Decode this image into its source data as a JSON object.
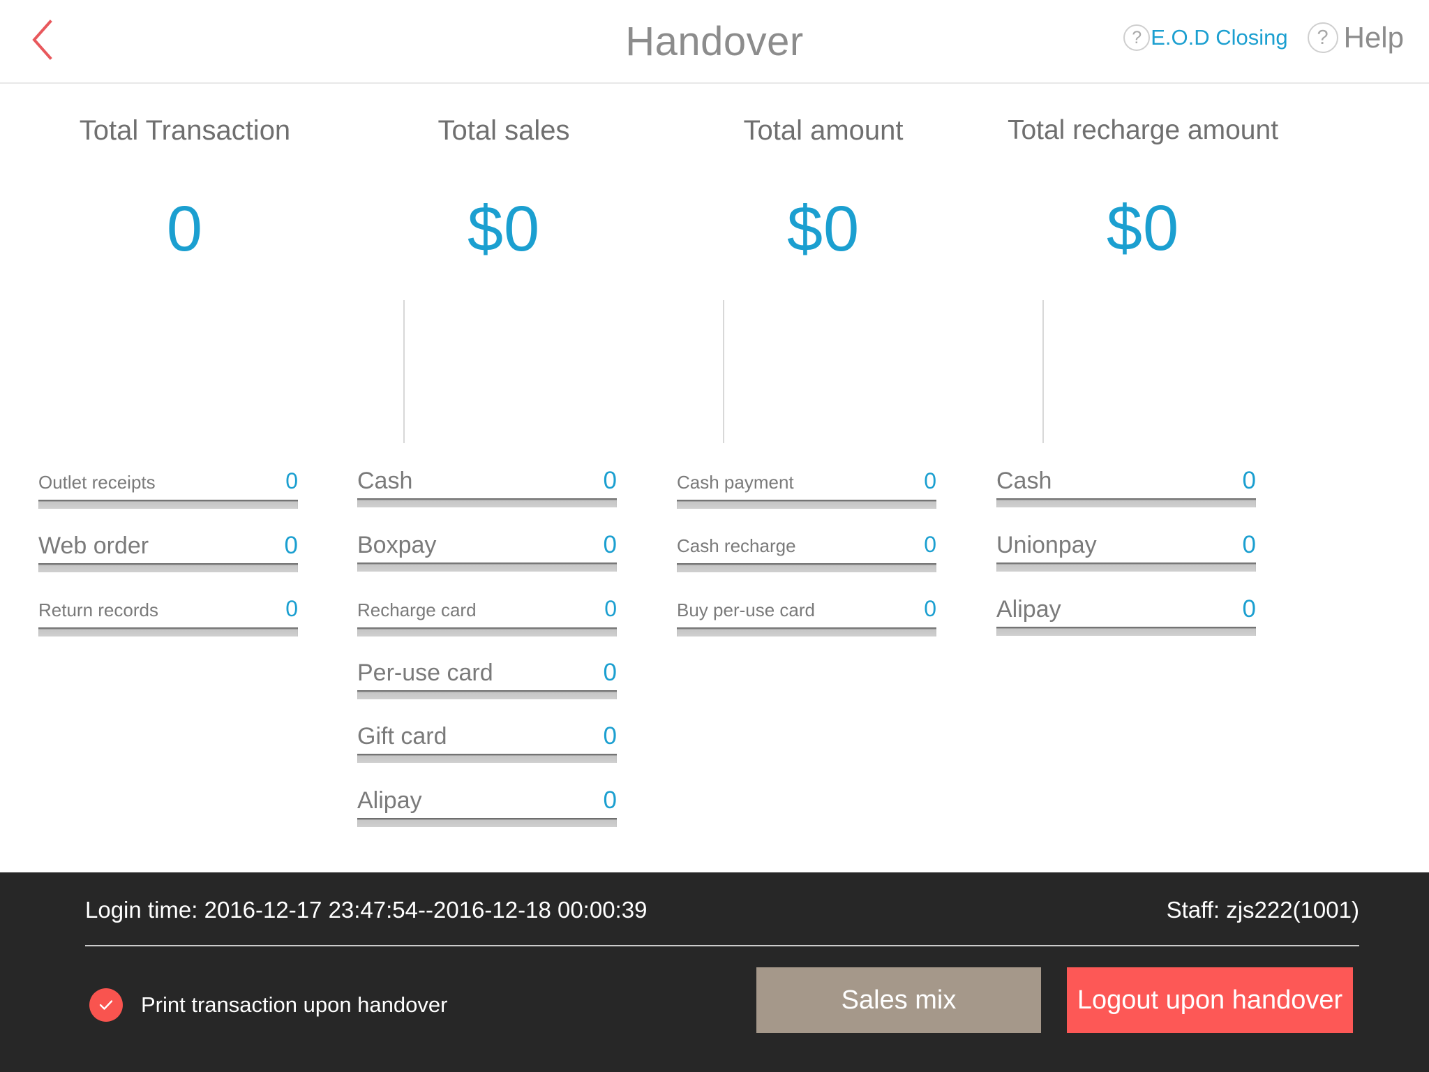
{
  "header": {
    "back_icon": "chevron-left-icon",
    "title": "Handover",
    "eod": {
      "icon": "question-mark-icon",
      "label": "E.O.D Closing"
    },
    "help": {
      "icon": "question-mark-icon",
      "label": "Help"
    },
    "accent_blue": "#1b9fd0",
    "back_red": "#e8585c"
  },
  "columns": [
    {
      "title": "Total Transaction",
      "total": "0",
      "label_size": "sz-sm",
      "rows": [
        {
          "label": "Outlet receipts",
          "value": "0",
          "size": "sz-sm"
        },
        {
          "label": "Web order",
          "value": "0",
          "size": "sz-lg"
        },
        {
          "label": "Return records",
          "value": "0",
          "size": "sz-sm"
        }
      ]
    },
    {
      "title": "Total sales",
      "total": "$0",
      "label_size": "sz-lg",
      "rows": [
        {
          "label": "Cash",
          "value": "0",
          "size": "sz-lg"
        },
        {
          "label": "Boxpay",
          "value": "0",
          "size": "sz-lg"
        },
        {
          "label": "Recharge card",
          "value": "0",
          "size": "sz-sm"
        },
        {
          "label": "Per-use card",
          "value": "0",
          "size": "sz-lg"
        },
        {
          "label": "Gift card",
          "value": "0",
          "size": "sz-lg"
        },
        {
          "label": "Alipay",
          "value": "0",
          "size": "sz-lg"
        }
      ]
    },
    {
      "title": "Total amount",
      "total": "$0",
      "label_size": "sz-sm",
      "rows": [
        {
          "label": "Cash payment",
          "value": "0",
          "size": "sz-sm"
        },
        {
          "label": "Cash recharge",
          "value": "0",
          "size": "sz-sm"
        },
        {
          "label": "Buy per-use card",
          "value": "0",
          "size": "sz-sm"
        }
      ]
    },
    {
      "title": "Total recharge amount",
      "total": "$0",
      "label_size": "sz-lg",
      "rows": [
        {
          "label": "Cash",
          "value": "0",
          "size": "sz-lg"
        },
        {
          "label": "Unionpay",
          "value": "0",
          "size": "sz-lg"
        },
        {
          "label": "Alipay",
          "value": "0",
          "size": "sz-lg"
        }
      ]
    }
  ],
  "footer": {
    "login_time": "Login time: 2016-12-17 23:47:54--2016-12-18 00:00:39",
    "staff": "Staff: zjs222(1001)",
    "print_checkbox": {
      "icon": "check-icon",
      "checked": true,
      "label": "Print transaction upon handover",
      "color": "#f9544f"
    },
    "sales_mix_button": {
      "label": "Sales mix",
      "color": "#a5988a"
    },
    "logout_button": {
      "label": "Logout upon handover",
      "color": "#fd5856"
    },
    "background": "#272727"
  }
}
